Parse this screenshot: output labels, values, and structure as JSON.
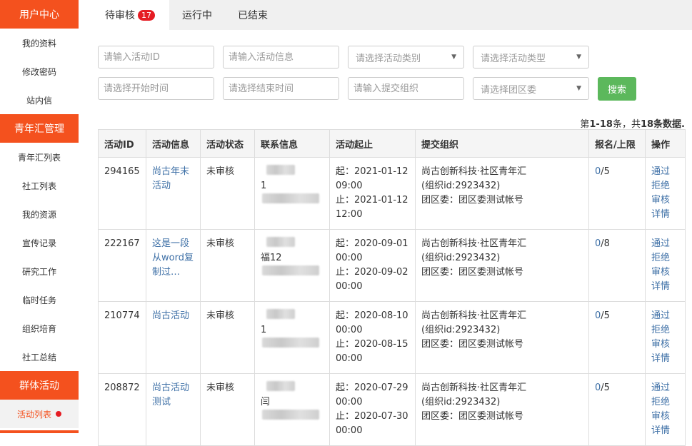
{
  "sidebar": {
    "sections": [
      {
        "title": "用户中心",
        "items": [
          "我的资料",
          "修改密码",
          "站内信"
        ]
      },
      {
        "title": "青年汇管理",
        "items": [
          "青年汇列表",
          "社工列表",
          "我的资源",
          "宣传记录",
          "研究工作",
          "临时任务",
          "组织培育",
          "社工总结"
        ]
      },
      {
        "title": "群体活动",
        "items": [
          "活动列表"
        ]
      }
    ]
  },
  "tabs": [
    {
      "label": "待审核",
      "badge": "17"
    },
    {
      "label": "运行中"
    },
    {
      "label": "已结束"
    }
  ],
  "filters": {
    "activity_id": "请输入活动ID",
    "activity_info": "请输入活动信息",
    "activity_category": "请选择活动类别",
    "activity_type": "请选择活动类型",
    "start_time": "请选择开始时间",
    "end_time": "请选择结束时间",
    "submit_org": "请输入提交组织",
    "district": "请选择团区委",
    "search": "搜索"
  },
  "summary": {
    "prefix": "第",
    "range": "1-18",
    "mid": "条，共",
    "total": "18",
    "suffix": "条数据."
  },
  "table": {
    "headers": [
      "活动ID",
      "活动信息",
      "活动状态",
      "联系信息",
      "活动起止",
      "提交组织",
      "报名/上限",
      "操作"
    ],
    "rows": [
      {
        "id": "294165",
        "info": "尚古年末活动",
        "status": "未审核",
        "contact": "1",
        "start_label": "起：",
        "start": "2021-01-12 09:00",
        "end_label": "止：",
        "end": "2021-01-12 12:00",
        "org": "尚古创新科技·社区青年汇",
        "org_id": "(组织id:2923432)",
        "district": "团区委：团区委测试帐号",
        "signup": "0",
        "limit": "/5"
      },
      {
        "id": "222167",
        "info": "这是一段从word复制过…",
        "status": "未审核",
        "contact": "福12",
        "start_label": "起：",
        "start": "2020-09-01 00:00",
        "end_label": "止：",
        "end": "2020-09-02 00:00",
        "org": "尚古创新科技·社区青年汇",
        "org_id": "(组织id:2923432)",
        "district": "团区委：团区委测试帐号",
        "signup": "0",
        "limit": "/8"
      },
      {
        "id": "210774",
        "info": "尚古活动",
        "status": "未审核",
        "contact": "1",
        "start_label": "起：",
        "start": "2020-08-10 00:00",
        "end_label": "止：",
        "end": "2020-08-15 00:00",
        "org": "尚古创新科技·社区青年汇",
        "org_id": "(组织id:2923432)",
        "district": "团区委：团区委测试帐号",
        "signup": "0",
        "limit": "/5"
      },
      {
        "id": "208872",
        "info": "尚古活动测试",
        "status": "未审核",
        "contact": "闫",
        "start_label": "起：",
        "start": "2020-07-29 00:00",
        "end_label": "止：",
        "end": "2020-07-30 00:00",
        "org": "尚古创新科技·社区青年汇",
        "org_id": "(组织id:2923432)",
        "district": "团区委：团区委测试帐号",
        "signup": "0",
        "limit": "/5"
      }
    ],
    "ops": [
      "通过",
      "拒绝",
      "审核",
      "详情"
    ]
  },
  "colors": {
    "accent": "#f4511e",
    "link": "#3d6fa6",
    "success": "#5cb85c",
    "badge": "#e51c23"
  }
}
